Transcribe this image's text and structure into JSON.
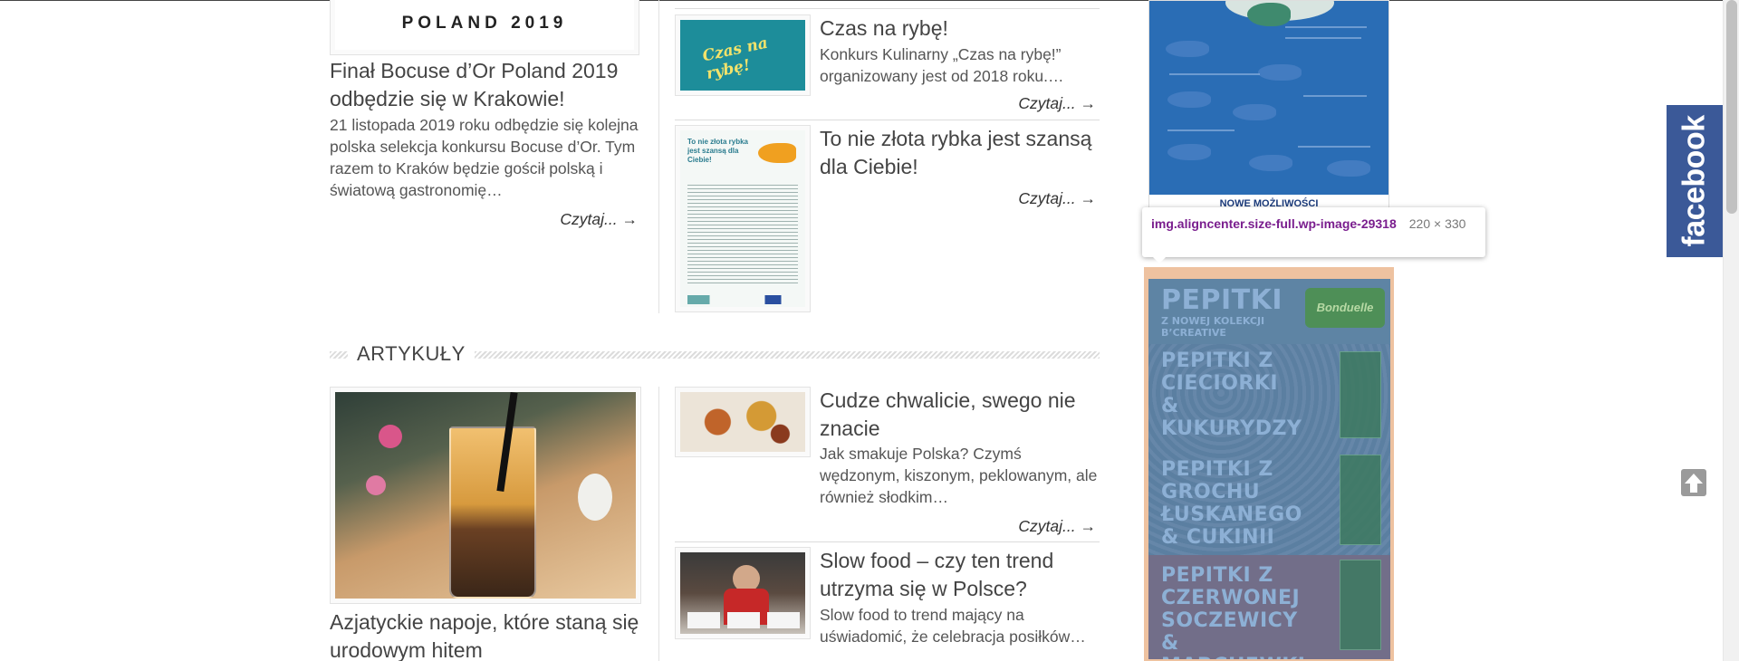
{
  "top_left_banner": {
    "text": "POLAND 2019"
  },
  "feature_left": {
    "title": "Finał Bocuse d’Or Poland 2019 odbędzie się w Krakowie!",
    "excerpt": "21 listopada 2019 roku odbędzie się kolejna polska selekcja konkursu Bocuse d’Or. Tym razem to Kraków będzie gościł polską i światową gastronomię…",
    "read_more": "Czytaj... →"
  },
  "side_posts_top": [
    {
      "title": "Czas na rybę!",
      "excerpt": "Konkurs Kulinarny „Czas na rybę!” organizowany jest od 2018 roku.…",
      "read_more": "Czytaj... →",
      "thumb_text": "Czas na rybę!"
    },
    {
      "title": "To nie złota rybka jest szansą dla Ciebie!",
      "read_more": "Czytaj... →",
      "thumb_text": "To nie złota rybka jest szansą dla Ciebie!"
    }
  ],
  "section": {
    "title": "ARTYKUŁY"
  },
  "feature_articles": {
    "title": "Azjatyckie napoje, które staną się urodowym hitem"
  },
  "side_posts_articles": [
    {
      "title": "Cudze chwalicie, swego nie znacie",
      "excerpt": "Jak smakuje Polska? Czymś wędzonym, kiszonym, peklowanym, ale również słodkim…",
      "read_more": "Czytaj... →"
    },
    {
      "title": "Slow food – czy ten trend utrzyma się w Polsce?",
      "excerpt": "Slow food to trend mający na uświadomić, że celebracja posiłków…"
    }
  ],
  "sidebar": {
    "poster_footer_text": "NOWE MOŻLIWOŚCI",
    "inspector_tooltip": {
      "selector": "img.aligncenter.size-full.wp-image-29318",
      "size": "220 × 330"
    },
    "pepitki_ad": {
      "heading": "PEPITKI",
      "subheading": "Z NOWEJ KOLEKCJI B’CREATIVE",
      "brand": "Bonduelle",
      "variants": [
        "PEPITKI Z CIECIORKI & KUKURYDZY",
        "PEPITKI Z GROCHU ŁUSKANEGO & CUKINII",
        "PEPITKI Z CZERWONEJ SOCZEWICY & MARCHEWKI"
      ]
    }
  },
  "facebook_tab": {
    "label": "facebook"
  },
  "icons": {
    "scroll_top": "arrow-up-icon"
  },
  "colors": {
    "facebook": "#3b5998",
    "ad_highlight": "#eec2a0",
    "poster_blue": "#2a6db5"
  }
}
